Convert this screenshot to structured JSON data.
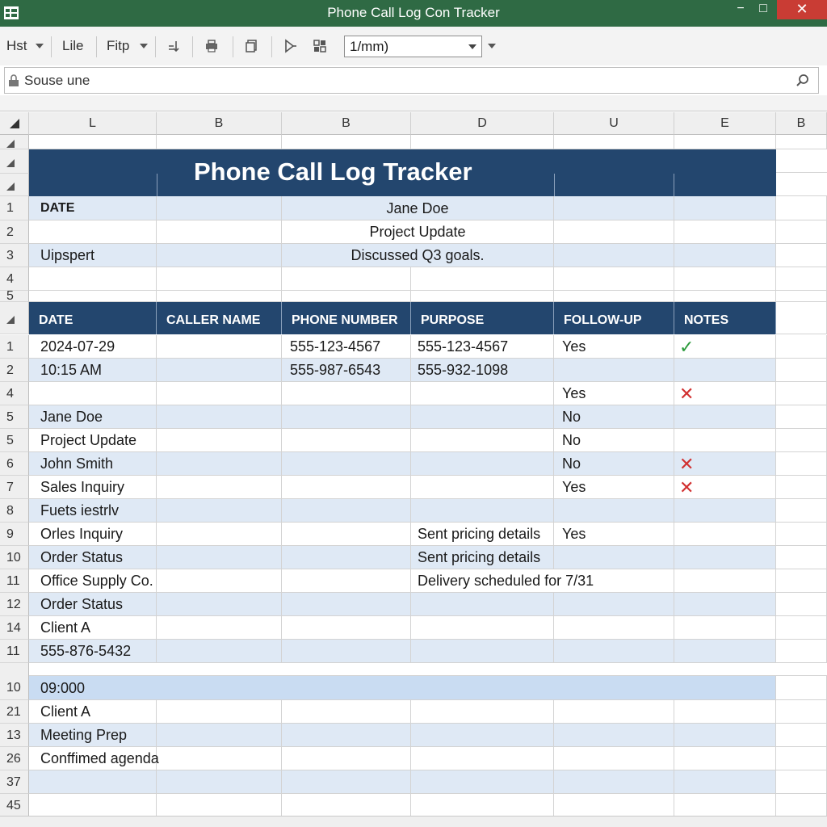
{
  "window": {
    "title": "Phone Call Log Con Tracker",
    "minimize": "▫",
    "maximize": "□",
    "close": "✕"
  },
  "toolbar": {
    "item1": "Hst",
    "item2": "Lile",
    "item3": "Fitp",
    "zoom_value": "1/mm)"
  },
  "search": {
    "value": "Souse une"
  },
  "columns": [
    "L",
    "B",
    "B",
    "D",
    "U",
    "E",
    "B"
  ],
  "sheet": {
    "title": "Phone Call Log Tracker",
    "summary": {
      "row_labels": [
        "",
        "1",
        "2",
        "3",
        "4",
        "5"
      ],
      "rows": [
        {
          "a": "DATE",
          "d": "Jane Doe"
        },
        {
          "a": "",
          "d": "Project Update"
        },
        {
          "a": "Uipspert",
          "d": "Discussed Q3 goals."
        }
      ]
    },
    "table": {
      "headers": [
        "DATE",
        "CALLER NAME",
        "PHONE NUMBER",
        "PURPOSE",
        "FOLLOW-UP",
        "NOTES"
      ],
      "rows": [
        {
          "rh": "1",
          "a": "2024-07-29",
          "c": "555-123-4567",
          "d": "555-123-4567",
          "e": "Yes",
          "f": "check"
        },
        {
          "rh": "2",
          "a": "10:15 AM",
          "c": "555-987-6543",
          "d": "555-932-1098",
          "e": "",
          "f": ""
        },
        {
          "rh": "4",
          "a": "",
          "c": "",
          "d": "",
          "e": "Yes",
          "f": "cross"
        },
        {
          "rh": "5",
          "a": "Jane Doe",
          "c": "",
          "d": "",
          "e": "No",
          "f": ""
        },
        {
          "rh": "5",
          "a": "Project Update",
          "c": "",
          "d": "",
          "e": "No",
          "f": ""
        },
        {
          "rh": "6",
          "a": "John Smith",
          "c": "",
          "d": "",
          "e": "No",
          "f": "cross"
        },
        {
          "rh": "7",
          "a": "Sales Inquiry",
          "c": "",
          "d": "",
          "e": "Yes",
          "f": "cross"
        },
        {
          "rh": "8",
          "a": "Fuets iestrlv",
          "c": "",
          "d": "",
          "e": "",
          "f": ""
        },
        {
          "rh": "9",
          "a": "Orles Inquiry",
          "c": "",
          "d": "Sent pricing details",
          "e": "Yes",
          "f": ""
        },
        {
          "rh": "10",
          "a": "Order Status",
          "c": "",
          "d": "Sent pricing details",
          "e": "",
          "f": ""
        },
        {
          "rh": "11",
          "a": "Office Supply Co.",
          "c": "",
          "d": "Delivery scheduled for 7/31",
          "e": "",
          "f": ""
        },
        {
          "rh": "12",
          "a": "Order Status",
          "c": "",
          "d": "",
          "e": "",
          "f": ""
        },
        {
          "rh": "14",
          "a": "Client A",
          "c": "",
          "d": "",
          "e": "",
          "f": ""
        },
        {
          "rh": "11",
          "a": "555-876-5432",
          "c": "",
          "d": "",
          "e": "",
          "f": ""
        }
      ]
    },
    "lower": {
      "rows": [
        {
          "rh": "10",
          "a": "09:000"
        },
        {
          "rh": "21",
          "a": "Client A"
        },
        {
          "rh": "13",
          "a": "Meeting Prep"
        },
        {
          "rh": "26",
          "a": "Conffimed agenda"
        },
        {
          "rh": "37",
          "a": ""
        },
        {
          "rh": "45",
          "a": ""
        }
      ]
    },
    "icons": {
      "check": "✓",
      "cross": "✕"
    }
  },
  "colors": {
    "titlebar": "#2f6a44",
    "navy": "#23466e",
    "band": "#dfe9f5",
    "close": "#c93c34",
    "check": "#2a9a3a",
    "cross": "#d13030"
  }
}
